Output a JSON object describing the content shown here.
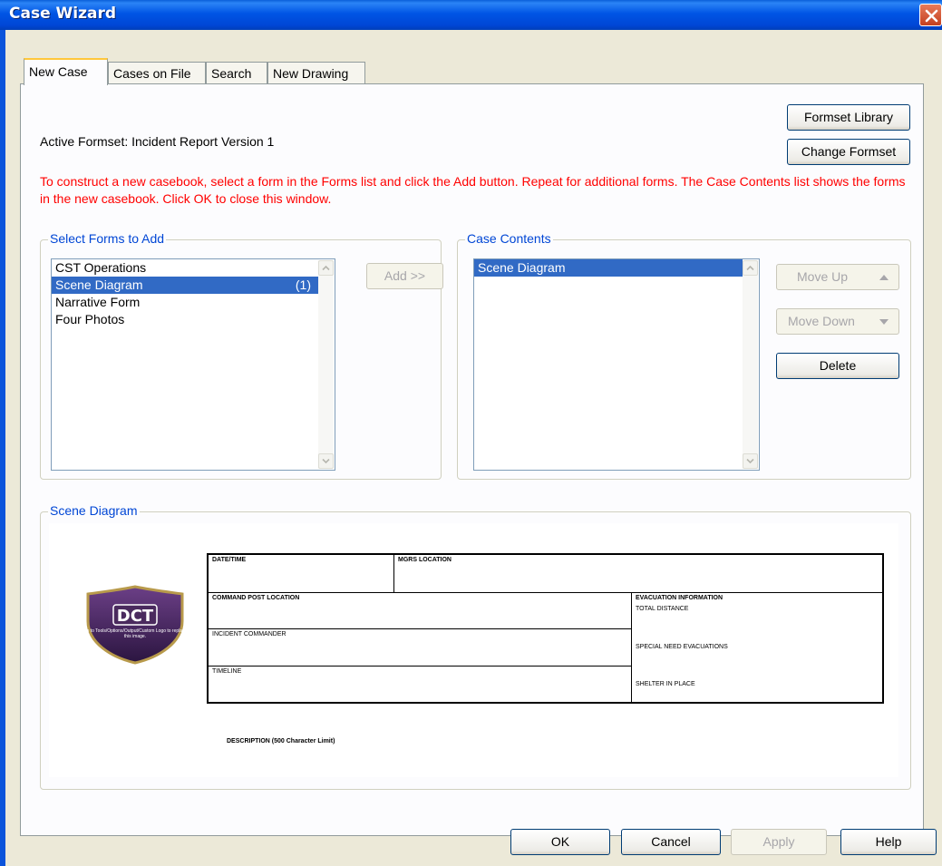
{
  "window": {
    "title": "Case Wizard"
  },
  "tabs": [
    {
      "label": "New Case"
    },
    {
      "label": "Cases on File"
    },
    {
      "label": "Search"
    },
    {
      "label": "New Drawing"
    }
  ],
  "active_formset": "Active Formset: Incident Report  Version 1",
  "buttons": {
    "formset_library": "Formset Library",
    "change_formset": "Change Formset",
    "add": "Add >>",
    "move_up": "Move Up",
    "move_down": "Move Down",
    "delete": "Delete",
    "ok": "OK",
    "cancel": "Cancel",
    "apply": "Apply",
    "help": "Help"
  },
  "instructions": "To construct a new casebook, select a form in the Forms list and click the Add button. Repeat for additional forms. The Case Contents list shows the forms in the new casebook. Click OK to close this window.",
  "select_forms": {
    "title": "Select Forms to Add",
    "items": [
      {
        "label": "CST Operations",
        "count": "",
        "selected": false
      },
      {
        "label": "Scene Diagram",
        "count": "(1)",
        "selected": true
      },
      {
        "label": "Narrative Form",
        "count": "",
        "selected": false
      },
      {
        "label": "Four Photos",
        "count": "",
        "selected": false
      }
    ]
  },
  "case_contents": {
    "title": "Case Contents",
    "items": [
      {
        "label": "Scene Diagram",
        "selected": true
      }
    ]
  },
  "preview": {
    "title": "Scene Diagram",
    "logo_text": "DCT",
    "logo_caption": "Go to Tools/Options/Output/Custom Logo to replace this image.",
    "form": {
      "date_time": "DATE/TIME",
      "mgrs_location": "MGRS LOCATION",
      "command_post_location": "COMMAND POST LOCATION",
      "evacuation_information": "EVACUATION INFORMATION",
      "total_distance": "TOTAL DISTANCE",
      "incident_commander": "INCIDENT COMMANDER",
      "special_need_evacuations": "SPECIAL NEED EVACUATIONS",
      "timeline": "TIMELINE",
      "shelter_in_place": "SHELTER IN PLACE",
      "description": "DESCRIPTION (500 Character Limit)"
    }
  },
  "colors": {
    "titlebar": "#0055e5",
    "group_title": "#0046d5",
    "instructions": "#ff0000",
    "selection": "#316ac5"
  }
}
